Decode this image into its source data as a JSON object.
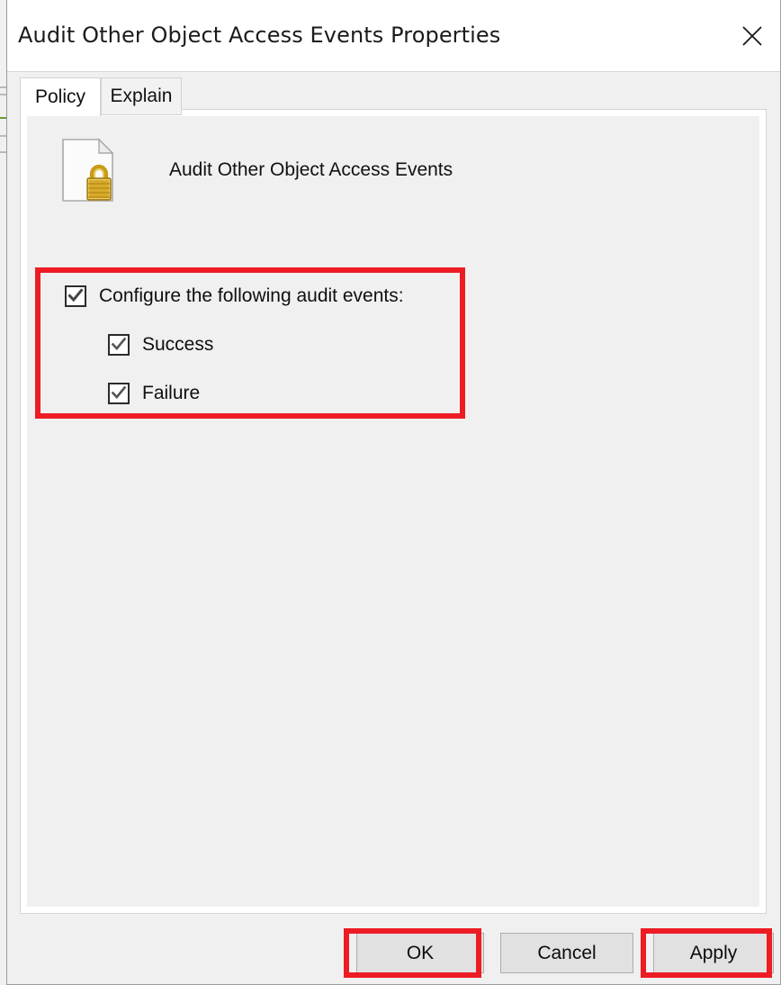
{
  "window": {
    "title": "Audit Other Object Access Events Properties",
    "close_icon": "close-icon"
  },
  "tabs": [
    {
      "label": "Policy",
      "active": true
    },
    {
      "label": "Explain",
      "active": false
    }
  ],
  "policy": {
    "icon": "policy-document-lock-icon",
    "name": "Audit Other Object Access Events"
  },
  "checkboxes": [
    {
      "label": "Configure the following audit events:",
      "checked": true,
      "indented": false
    },
    {
      "label": "Success",
      "checked": true,
      "indented": true
    },
    {
      "label": "Failure",
      "checked": true,
      "indented": true
    }
  ],
  "buttons": {
    "ok": "OK",
    "cancel": "Cancel",
    "apply": "Apply"
  },
  "annotations": {
    "color": "#ed1c24",
    "targets": [
      "configure-audit-events-group",
      "ok-button",
      "apply-button"
    ]
  }
}
